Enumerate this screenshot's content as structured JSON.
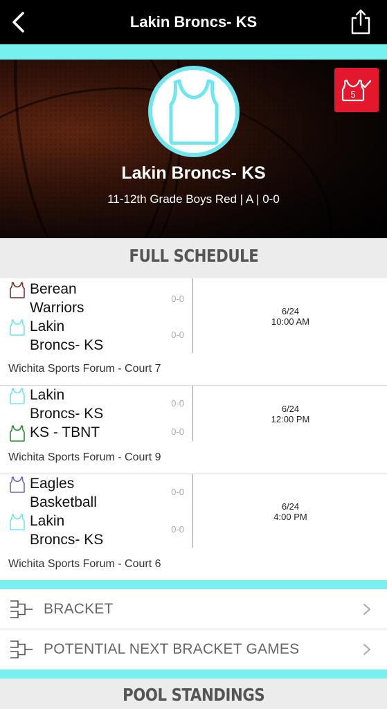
{
  "header": {
    "title": "Lakin Broncs- KS"
  },
  "hero": {
    "team_name": "Lakin Broncs- KS",
    "subtitle": "11-12th Grade Boys Red | A | 0-0",
    "badge_number": "5"
  },
  "schedule": {
    "heading": "FULL SCHEDULE",
    "games": [
      {
        "teams": [
          {
            "name_line1": "Berean",
            "name_line2": "Warriors",
            "score": "0-0",
            "color": "#7a3030"
          },
          {
            "name_line1": "Lakin",
            "name_line2": "Broncs- KS",
            "score": "0-0",
            "color": "#6fe6ee"
          }
        ],
        "date": "6/24",
        "time": "10:00 AM",
        "location": "Wichita Sports Forum - Court 7"
      },
      {
        "teams": [
          {
            "name_line1": "Lakin",
            "name_line2": "Broncs- KS",
            "score": "0-0",
            "color": "#6fe6ee"
          },
          {
            "name_line1": "KS - TBNT",
            "name_line2": "",
            "score": "0-0",
            "color": "#2e8b3a"
          }
        ],
        "date": "6/24",
        "time": "12:00 PM",
        "location": "Wichita Sports Forum - Court 9"
      },
      {
        "teams": [
          {
            "name_line1": "Eagles",
            "name_line2": "Basketball",
            "score": "0-0",
            "color": "#6a6ab8"
          },
          {
            "name_line1": "Lakin",
            "name_line2": "Broncs- KS",
            "score": "0-0",
            "color": "#6fe6ee"
          }
        ],
        "date": "6/24",
        "time": "4:00 PM",
        "location": "Wichita Sports Forum - Court 6"
      }
    ]
  },
  "menu": {
    "bracket": "BRACKET",
    "potential": "POTENTIAL NEXT BRACKET GAMES"
  },
  "pool": {
    "heading": "POOL STANDINGS"
  },
  "colors": {
    "accent": "#77f0f0",
    "badge": "#e3182c",
    "topbar": "#000000"
  }
}
